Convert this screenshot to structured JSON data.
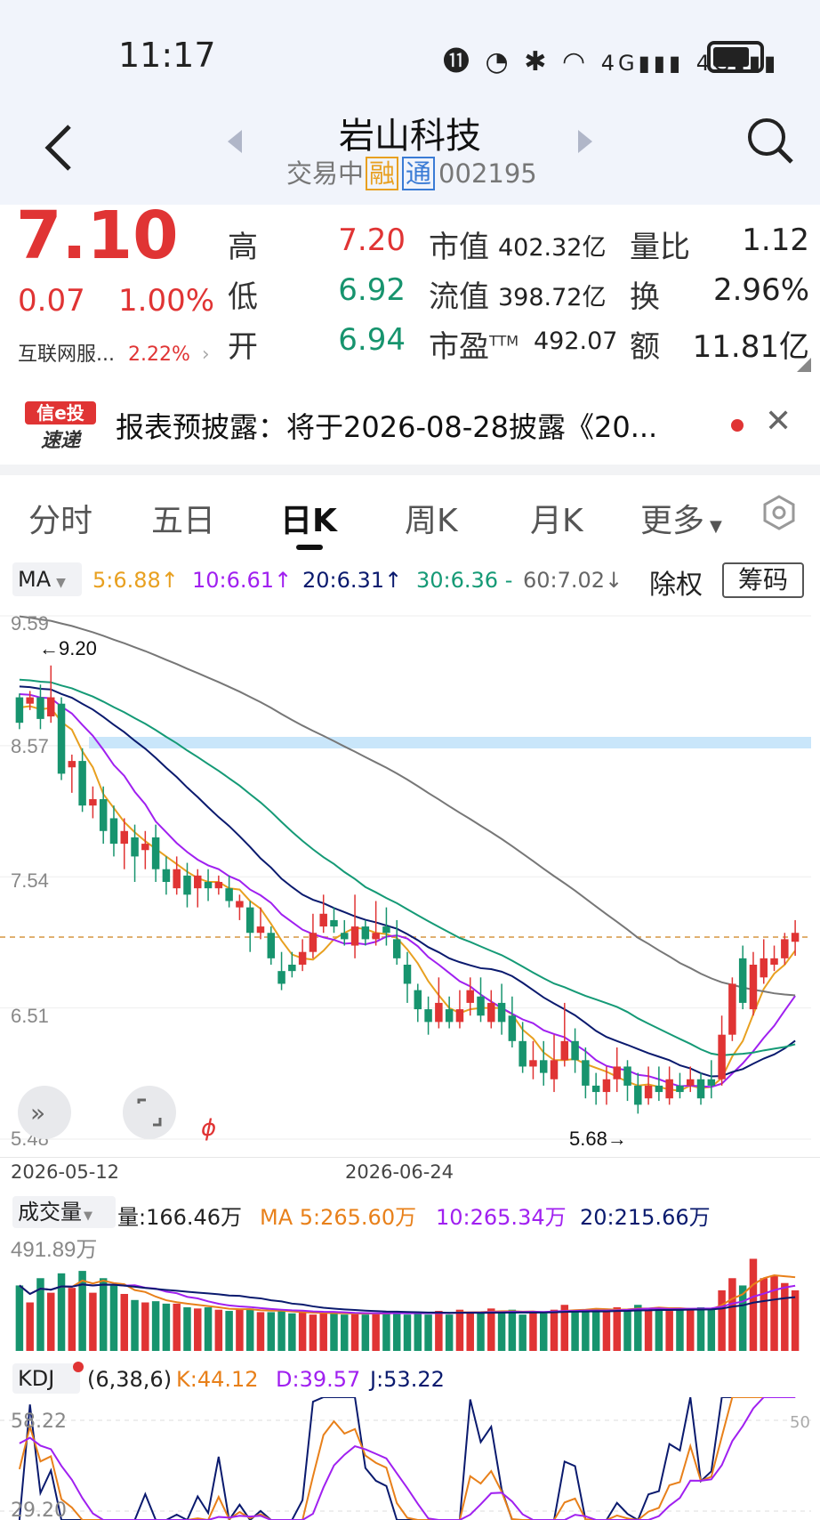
{
  "status": {
    "time": "11:17"
  },
  "header": {
    "name": "岩山科技",
    "trade_status": "交易中",
    "badge_rong": "融",
    "badge_tong": "通",
    "code": "002195"
  },
  "quote": {
    "price": "7.10",
    "change": "0.07",
    "change_pct": "1.00%",
    "sector": "互联网服...",
    "sector_pct": "2.22%",
    "high_label": "高",
    "high": "7.20",
    "low_label": "低",
    "low": "6.92",
    "open_label": "开",
    "open": "6.94",
    "mktcap_label": "市值",
    "mktcap": "402.32亿",
    "float_label": "流值",
    "float": "398.72亿",
    "pe_label": "市盈",
    "pe_sup": "TTM",
    "pe": "492.07",
    "vr_label": "量比",
    "vr": "1.12",
    "turnover_label": "换",
    "turnover": "2.96%",
    "amount_label": "额",
    "amount": "11.81亿"
  },
  "news": {
    "logo_top": "信e投",
    "logo_bottom": "速递",
    "text": "报表预披露：将于2026-08-28披露《20..."
  },
  "tabs": [
    "分时",
    "五日",
    "日K",
    "周K",
    "月K",
    "更多"
  ],
  "ma_bar": {
    "dropdown": "MA",
    "ma5": "5:6.88",
    "ma10": "10:6.61",
    "ma20": "20:6.31",
    "ma30": "30:6.36 -",
    "ma60": "60:7.02",
    "fq": "除权",
    "chip": "筹码"
  },
  "price_axis": {
    "top": "9.59",
    "l2": "8.57",
    "l3": "7.54",
    "l4": "6.51",
    "bottom": "5.48"
  },
  "annotations": {
    "high_mark": "←9.20",
    "low_mark": "5.68→"
  },
  "dates": [
    "2026-05-12",
    "2026-06-24"
  ],
  "vol_bar": {
    "dropdown": "成交量",
    "vol": "量:166.46万",
    "ma5": "MA 5:265.60万",
    "ma10": "10:265.34万",
    "ma20": "20:215.66万",
    "max": "491.89万"
  },
  "kdj_bar": {
    "dropdown": "KDJ",
    "params": "(6,38,6)",
    "k": "K:44.12",
    "d": "D:39.57",
    "j": "J:53.22",
    "top": "58.22",
    "bottom": "29.20",
    "right": "50"
  },
  "colors": {
    "up": "#e03434",
    "down": "#17946e",
    "ma5": "#e8a020",
    "ma10": "#a020f0",
    "ma20": "#0a1a6e",
    "ma30": "#159a76",
    "ma60": "#777777"
  },
  "chart_data": {
    "type": "candlestick",
    "candles": [
      [
        8.95,
        8.75,
        8.98,
        8.7
      ],
      [
        8.9,
        8.95,
        9.0,
        8.85
      ],
      [
        8.95,
        8.78,
        9.05,
        8.7
      ],
      [
        8.8,
        8.95,
        9.2,
        8.75
      ],
      [
        8.9,
        8.35,
        8.95,
        8.3
      ],
      [
        8.4,
        8.45,
        8.5,
        8.2
      ],
      [
        8.45,
        8.1,
        8.55,
        8.05
      ],
      [
        8.1,
        8.15,
        8.25,
        8.0
      ],
      [
        8.15,
        7.9,
        8.25,
        7.8
      ],
      [
        8.0,
        7.8,
        8.1,
        7.7
      ],
      [
        7.8,
        7.9,
        8.0,
        7.6
      ],
      [
        7.85,
        7.7,
        7.95,
        7.5
      ],
      [
        7.75,
        7.8,
        7.9,
        7.6
      ],
      [
        7.85,
        7.6,
        7.95,
        7.5
      ],
      [
        7.6,
        7.5,
        7.7,
        7.4
      ],
      [
        7.45,
        7.6,
        7.7,
        7.4
      ],
      [
        7.55,
        7.4,
        7.65,
        7.3
      ],
      [
        7.45,
        7.55,
        7.6,
        7.3
      ],
      [
        7.5,
        7.45,
        7.6,
        7.35
      ],
      [
        7.45,
        7.5,
        7.55,
        7.4
      ],
      [
        7.45,
        7.35,
        7.55,
        7.3
      ],
      [
        7.3,
        7.35,
        7.4,
        7.2
      ],
      [
        7.3,
        7.1,
        7.35,
        6.95
      ],
      [
        7.1,
        7.15,
        7.3,
        7.05
      ],
      [
        7.1,
        6.9,
        7.15,
        6.85
      ],
      [
        6.8,
        6.7,
        6.95,
        6.65
      ],
      [
        6.85,
        6.8,
        6.95,
        6.75
      ],
      [
        6.85,
        6.95,
        7.05,
        6.8
      ],
      [
        6.95,
        7.1,
        7.25,
        6.9
      ],
      [
        7.15,
        7.25,
        7.4,
        7.1
      ],
      [
        7.2,
        7.15,
        7.3,
        7.1
      ],
      [
        7.1,
        7.05,
        7.2,
        7.0
      ],
      [
        7.0,
        7.15,
        7.4,
        6.9
      ],
      [
        7.15,
        7.05,
        7.2,
        7.0
      ],
      [
        7.05,
        7.1,
        7.35,
        7.0
      ],
      [
        7.15,
        7.1,
        7.3,
        7.0
      ],
      [
        7.05,
        6.9,
        7.2,
        6.85
      ],
      [
        6.85,
        6.7,
        6.95,
        6.55
      ],
      [
        6.65,
        6.5,
        6.7,
        6.4
      ],
      [
        6.5,
        6.4,
        6.6,
        6.3
      ],
      [
        6.4,
        6.55,
        6.75,
        6.35
      ],
      [
        6.5,
        6.4,
        6.6,
        6.35
      ],
      [
        6.4,
        6.5,
        6.65,
        6.35
      ],
      [
        6.55,
        6.65,
        6.75,
        6.45
      ],
      [
        6.6,
        6.45,
        6.75,
        6.4
      ],
      [
        6.4,
        6.55,
        6.65,
        6.35
      ],
      [
        6.55,
        6.4,
        6.7,
        6.3
      ],
      [
        6.45,
        6.25,
        6.6,
        6.2
      ],
      [
        6.25,
        6.05,
        6.4,
        6.0
      ],
      [
        6.05,
        6.1,
        6.25,
        5.95
      ],
      [
        6.1,
        6.0,
        6.25,
        5.9
      ],
      [
        5.95,
        6.1,
        6.3,
        5.85
      ],
      [
        6.1,
        6.25,
        6.55,
        6.05
      ],
      [
        6.25,
        6.1,
        6.35,
        6.0
      ],
      [
        6.1,
        5.9,
        6.2,
        5.8
      ],
      [
        5.9,
        5.85,
        6.0,
        5.75
      ],
      [
        5.85,
        5.95,
        6.05,
        5.75
      ],
      [
        5.95,
        6.05,
        6.2,
        5.85
      ],
      [
        6.05,
        5.9,
        6.1,
        5.78
      ],
      [
        5.9,
        5.75,
        6.0,
        5.68
      ],
      [
        5.8,
        5.9,
        6.05,
        5.75
      ],
      [
        5.9,
        5.85,
        6.05,
        5.78
      ],
      [
        5.8,
        5.95,
        6.05,
        5.75
      ],
      [
        5.9,
        5.85,
        6.0,
        5.8
      ],
      [
        5.9,
        5.95,
        6.05,
        5.85
      ],
      [
        5.95,
        5.8,
        6.0,
        5.75
      ],
      [
        5.95,
        5.9,
        6.1,
        5.8
      ],
      [
        5.95,
        6.3,
        6.45,
        5.9
      ],
      [
        6.3,
        6.7,
        6.75,
        6.25
      ],
      [
        6.9,
        6.55,
        7.0,
        6.5
      ],
      [
        6.5,
        6.85,
        6.95,
        6.45
      ],
      [
        6.75,
        6.9,
        7.05,
        6.7
      ],
      [
        6.85,
        6.9,
        7.0,
        6.8
      ],
      [
        6.9,
        7.05,
        7.1,
        6.85
      ],
      [
        7.03,
        7.1,
        7.2,
        6.92
      ]
    ],
    "volume": [
      270,
      200,
      300,
      240,
      320,
      260,
      330,
      240,
      300,
      270,
      235,
      210,
      200,
      205,
      195,
      195,
      180,
      175,
      180,
      170,
      165,
      170,
      175,
      160,
      160,
      165,
      155,
      160,
      150,
      155,
      160,
      150,
      155,
      150,
      155,
      160,
      165,
      150,
      160,
      150,
      165,
      150,
      170,
      160,
      155,
      175,
      160,
      170,
      150,
      160,
      155,
      170,
      190,
      165,
      170,
      175,
      160,
      180,
      170,
      190,
      175,
      180,
      165,
      170,
      175,
      180,
      170,
      250,
      300,
      270,
      380,
      300,
      310,
      280,
      250
    ],
    "y_range": [
      5.48,
      9.59
    ],
    "notes": [
      "←9.20",
      "5.68→"
    ]
  }
}
